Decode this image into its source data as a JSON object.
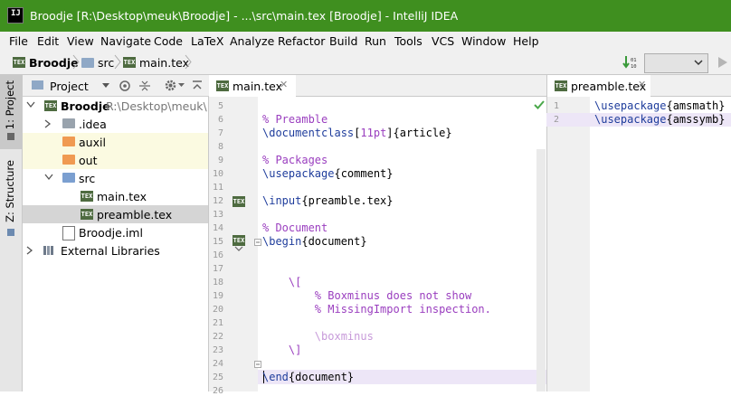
{
  "window": {
    "title": "Broodje [R:\\Desktop\\meuk\\Broodje] - ...\\src\\main.tex [Broodje] - IntelliJ IDEA"
  },
  "menu": [
    "File",
    "Edit",
    "View",
    "Navigate",
    "Code",
    "LaTeX",
    "Analyze",
    "Refactor",
    "Build",
    "Run",
    "Tools",
    "VCS",
    "Window",
    "Help"
  ],
  "breadcrumb": [
    "Broodje",
    "src",
    "main.tex"
  ],
  "side_tabs": {
    "project": "1: Project",
    "structure": "Z: Structure"
  },
  "project_panel": {
    "header": "Project",
    "tree": [
      {
        "label": "Broodje",
        "path": "R:\\Desktop\\meuk\\Broodje",
        "kind": "module",
        "expanded": true
      },
      {
        "label": ".idea",
        "kind": "folder"
      },
      {
        "label": "auxil",
        "kind": "folder-excluded"
      },
      {
        "label": "out",
        "kind": "folder-excluded"
      },
      {
        "label": "src",
        "kind": "folder-source",
        "expanded": true
      },
      {
        "label": "main.tex",
        "kind": "tex"
      },
      {
        "label": "preamble.tex",
        "kind": "tex",
        "selected": true
      },
      {
        "label": "Broodje.iml",
        "kind": "iml"
      },
      {
        "label": "External Libraries",
        "kind": "libraries"
      }
    ]
  },
  "editor_left": {
    "tab": "main.tex",
    "lines": [
      {
        "n": "5",
        "parts": []
      },
      {
        "n": "6",
        "parts": [
          {
            "c": "cmt",
            "t": "% Preamble"
          }
        ]
      },
      {
        "n": "7",
        "parts": [
          {
            "c": "kw",
            "t": "\\documentclass"
          },
          {
            "c": "arg",
            "t": "["
          },
          {
            "c": "opt",
            "t": "11pt"
          },
          {
            "c": "arg",
            "t": "]{article}"
          }
        ]
      },
      {
        "n": "8",
        "parts": []
      },
      {
        "n": "9",
        "parts": [
          {
            "c": "cmt",
            "t": "% Packages"
          }
        ]
      },
      {
        "n": "10",
        "parts": [
          {
            "c": "kw",
            "t": "\\usepackage"
          },
          {
            "c": "arg",
            "t": "{comment}"
          }
        ]
      },
      {
        "n": "11",
        "parts": []
      },
      {
        "n": "12",
        "parts": [
          {
            "c": "kw",
            "t": "\\input"
          },
          {
            "c": "arg",
            "t": "{preamble.tex}"
          }
        ]
      },
      {
        "n": "13",
        "parts": []
      },
      {
        "n": "14",
        "parts": [
          {
            "c": "cmt",
            "t": "% Document"
          }
        ]
      },
      {
        "n": "15",
        "parts": [
          {
            "c": "kw",
            "t": "\\begin"
          },
          {
            "c": "arg",
            "t": "{document}"
          }
        ]
      },
      {
        "n": "16",
        "parts": []
      },
      {
        "n": "17",
        "parts": []
      },
      {
        "n": "18",
        "parts": [
          {
            "c": "math",
            "t": "    \\["
          }
        ]
      },
      {
        "n": "19",
        "parts": [
          {
            "c": "cmt",
            "t": "        % Boxminus does not show"
          }
        ]
      },
      {
        "n": "20",
        "parts": [
          {
            "c": "cmt",
            "t": "        % MissingImport inspection."
          }
        ]
      },
      {
        "n": "21",
        "parts": []
      },
      {
        "n": "22",
        "parts": [
          {
            "c": "mathfaint",
            "t": "        \\boxminus"
          }
        ]
      },
      {
        "n": "23",
        "parts": [
          {
            "c": "math",
            "t": "    \\]"
          }
        ]
      },
      {
        "n": "24",
        "parts": []
      },
      {
        "n": "25",
        "parts": [
          {
            "c": "kw",
            "t": "\\end"
          },
          {
            "c": "arg",
            "t": "{document}"
          }
        ]
      },
      {
        "n": "26",
        "parts": []
      }
    ]
  },
  "editor_right": {
    "tab": "preamble.tex",
    "lines": [
      {
        "n": "1",
        "parts": [
          {
            "c": "kw",
            "t": "\\usepackage"
          },
          {
            "c": "arg",
            "t": "{amsmath}"
          }
        ]
      },
      {
        "n": "2",
        "parts": [
          {
            "c": "kw",
            "t": "\\usepackage"
          },
          {
            "c": "arg",
            "t": "{amssymb}"
          }
        ]
      }
    ]
  },
  "colors": {
    "titlebar": "#3f8f1f",
    "comment": "#9a3ebf",
    "keyword": "#1f3d9c",
    "current_line": "#ede6f7"
  }
}
